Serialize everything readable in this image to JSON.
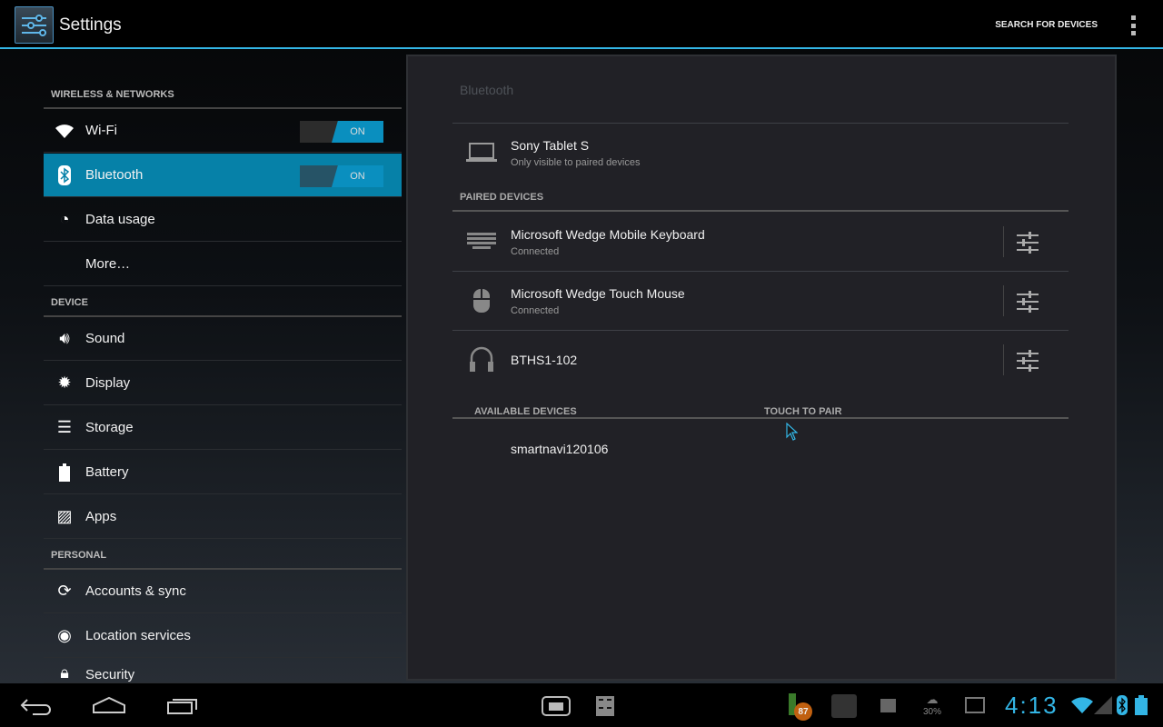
{
  "app": {
    "title": "Settings",
    "search_label": "SEARCH FOR DEVICES"
  },
  "sidebar": {
    "sections": [
      "WIRELESS & NETWORKS",
      "DEVICE",
      "PERSONAL"
    ],
    "items": [
      {
        "label": "Wi-Fi",
        "toggle": "ON"
      },
      {
        "label": "Bluetooth",
        "toggle": "ON"
      },
      {
        "label": "Data usage"
      },
      {
        "label": "More…"
      },
      {
        "label": "Sound"
      },
      {
        "label": "Display"
      },
      {
        "label": "Storage"
      },
      {
        "label": "Battery"
      },
      {
        "label": "Apps"
      },
      {
        "label": "Accounts & sync"
      },
      {
        "label": "Location services"
      },
      {
        "label": "Security"
      }
    ]
  },
  "bluetooth": {
    "title": "Bluetooth",
    "this_device": {
      "name": "Sony Tablet S",
      "status": "Only visible to paired devices"
    },
    "paired_header": "PAIRED DEVICES",
    "paired": [
      {
        "name": "Microsoft Wedge Mobile Keyboard",
        "status": "Connected"
      },
      {
        "name": "Microsoft Wedge Touch Mouse",
        "status": "Connected"
      },
      {
        "name": "BTHS1-102"
      }
    ],
    "available_header": "AVAILABLE DEVICES",
    "touch_to_pair": "TOUCH TO PAIR",
    "available": [
      {
        "name": "smartnavi120106"
      }
    ]
  },
  "status": {
    "battery_badge": "87",
    "weather": "30%",
    "time": "4:13"
  },
  "colors": {
    "accent": "#33b5e5",
    "selected": "#0681a8"
  }
}
